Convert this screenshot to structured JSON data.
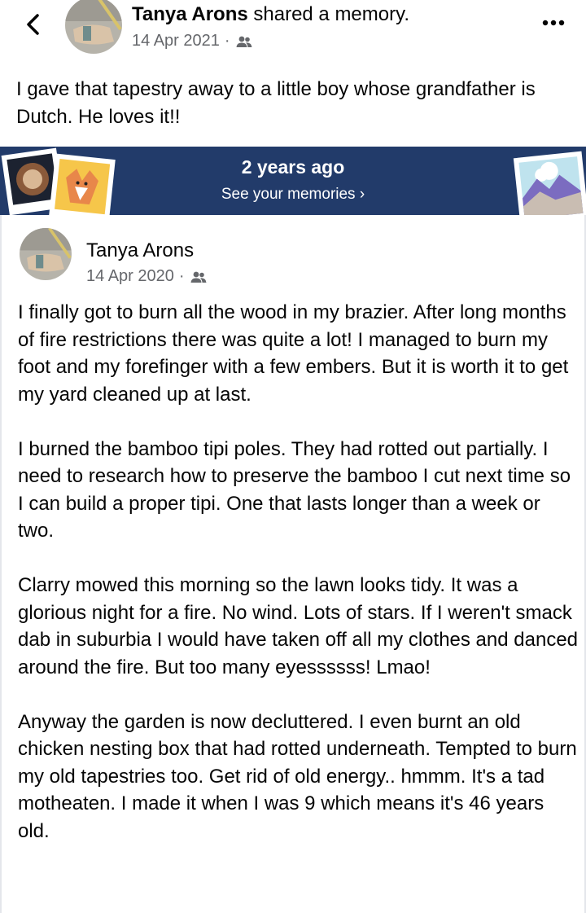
{
  "header": {
    "author": "Tanya Arons",
    "action": "shared a memory.",
    "date": "14 Apr 2021",
    "separator": "·"
  },
  "post": {
    "text": "I gave that tapestry away to a little boy whose grandfather is Dutch.  He loves it!!"
  },
  "banner": {
    "years_ago": "2 years ago",
    "link_label": "See your memories ›",
    "bg_color": "#223b6a"
  },
  "memory": {
    "author": "Tanya Arons",
    "date": "14 Apr 2020",
    "separator": "·",
    "paragraphs": [
      "I finally got to burn all the wood in my brazier.  After long months of fire restrictions there was quite a lot!  I managed to burn my foot and my forefinger with a few embers.  But it is worth it to get my yard cleaned up at last.",
      "I burned the bamboo tipi poles. They had rotted out partially.  I need to research how to preserve the bamboo I cut next time so I can  build a proper tipi.  One that lasts longer than a week or two.",
      "Clarry mowed this morning so the lawn looks tidy.  It was a glorious night for a fire.  No wind.  Lots of stars.  If I weren't smack dab in suburbia I would have taken off all my clothes and danced around the fire.  But too many eyessssss!  Lmao!",
      "Anyway the garden is now decluttered.  I even burnt an old chicken nesting box that had rotted underneath. Tempted to burn my old tapestries too.  Get rid of old energy..  hmmm.  It's a tad motheaten.  I made it when I was 9 which means it's 46 years old."
    ]
  },
  "icons": {
    "back": "chevron-left-icon",
    "more": "more-horizontal-icon",
    "audience": "friends-icon"
  }
}
